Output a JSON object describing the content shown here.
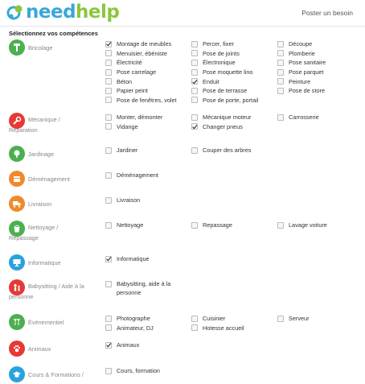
{
  "header": {
    "logo_need": "need",
    "logo_help": "help",
    "post_link": "Poster un besoin"
  },
  "section_title": "Sélectionnez vos compétences",
  "categories": [
    {
      "name": "Bricolage",
      "color": "#4caf50",
      "icon": "hammer-icon",
      "cols": [
        [
          {
            "label": "Montage de meubles",
            "checked": true
          },
          {
            "label": "Menuisier, ébéniste",
            "checked": false
          },
          {
            "label": "Électricité",
            "checked": false
          },
          {
            "label": "Pose carrelage",
            "checked": false
          },
          {
            "label": "Béton",
            "checked": false
          },
          {
            "label": "Papier peint",
            "checked": false
          },
          {
            "label": "Pose de fenêtres, volet",
            "checked": false
          }
        ],
        [
          {
            "label": "Percer, fixer",
            "checked": false
          },
          {
            "label": "Pose de joints",
            "checked": false
          },
          {
            "label": "Électronique",
            "checked": false
          },
          {
            "label": "Pose moquette lino",
            "checked": false
          },
          {
            "label": "Enduit",
            "checked": true
          },
          {
            "label": "Pose de terrasse",
            "checked": false
          },
          {
            "label": "Pose de porte, portail",
            "checked": false
          }
        ],
        [
          {
            "label": "Découpe",
            "checked": false
          },
          {
            "label": "Plomberie",
            "checked": false
          },
          {
            "label": "Pose sanitaire",
            "checked": false
          },
          {
            "label": "Pose parquet",
            "checked": false
          },
          {
            "label": "Peinture",
            "checked": false
          },
          {
            "label": "Pose de store",
            "checked": false
          }
        ]
      ]
    },
    {
      "name": "Mécanique / Réparation",
      "color": "#e53935",
      "icon": "wrench-icon",
      "cols": [
        [
          {
            "label": "Monter, démonter",
            "checked": false
          },
          {
            "label": "Vidange",
            "checked": false
          }
        ],
        [
          {
            "label": "Mécanique moteur",
            "checked": false
          },
          {
            "label": "Changer pneus",
            "checked": true
          }
        ],
        [
          {
            "label": "Carrosserie",
            "checked": false
          }
        ]
      ]
    },
    {
      "name": "Jardinage",
      "color": "#4caf50",
      "icon": "tree-icon",
      "cols": [
        [
          {
            "label": "Jardiner",
            "checked": false
          }
        ],
        [
          {
            "label": "Couper des arbres",
            "checked": false
          }
        ],
        []
      ]
    },
    {
      "name": "Déménagement",
      "color": "#ef8a2c",
      "icon": "box-icon",
      "cols": [
        [
          {
            "label": "Déménagement",
            "checked": false
          }
        ],
        [],
        []
      ]
    },
    {
      "name": "Livraison",
      "color": "#ef8a2c",
      "icon": "truck-icon",
      "cols": [
        [
          {
            "label": "Livraison",
            "checked": false
          }
        ],
        [],
        []
      ]
    },
    {
      "name": "Nettoyage / Repassage",
      "color": "#4caf50",
      "icon": "bucket-icon",
      "cols": [
        [
          {
            "label": "Nettoyage",
            "checked": false
          }
        ],
        [
          {
            "label": "Repassage",
            "checked": false
          }
        ],
        [
          {
            "label": "Lavage voiture",
            "checked": false
          }
        ]
      ]
    },
    {
      "name": "Informatique",
      "color": "#29a3dc",
      "icon": "monitor-icon",
      "cols": [
        [
          {
            "label": "Informatique",
            "checked": true
          }
        ],
        [],
        []
      ]
    },
    {
      "name": "Babysitting / Aide à la personne",
      "color": "#e53935",
      "icon": "people-icon",
      "cols": [
        [
          {
            "label": "Babysitting, aide à la personne",
            "checked": false
          }
        ],
        [],
        []
      ]
    },
    {
      "name": "Événementiel",
      "color": "#4caf50",
      "icon": "glass-icon",
      "cols": [
        [
          {
            "label": "Photographe",
            "checked": false
          },
          {
            "label": "Animateur, DJ",
            "checked": false
          }
        ],
        [
          {
            "label": "Cuisinier",
            "checked": false
          },
          {
            "label": "Hotesse accueil",
            "checked": false
          }
        ],
        [
          {
            "label": "Serveur",
            "checked": false
          }
        ]
      ]
    },
    {
      "name": "Animaux",
      "color": "#e53935",
      "icon": "paw-icon",
      "cols": [
        [
          {
            "label": "Animaux",
            "checked": true
          }
        ],
        [],
        []
      ]
    },
    {
      "name": "Cours & Formations /",
      "color": "#29a3dc",
      "icon": "graduation-cap-icon",
      "cols": [
        [
          {
            "label": "Cours, formation",
            "checked": false
          }
        ],
        [],
        []
      ]
    }
  ]
}
